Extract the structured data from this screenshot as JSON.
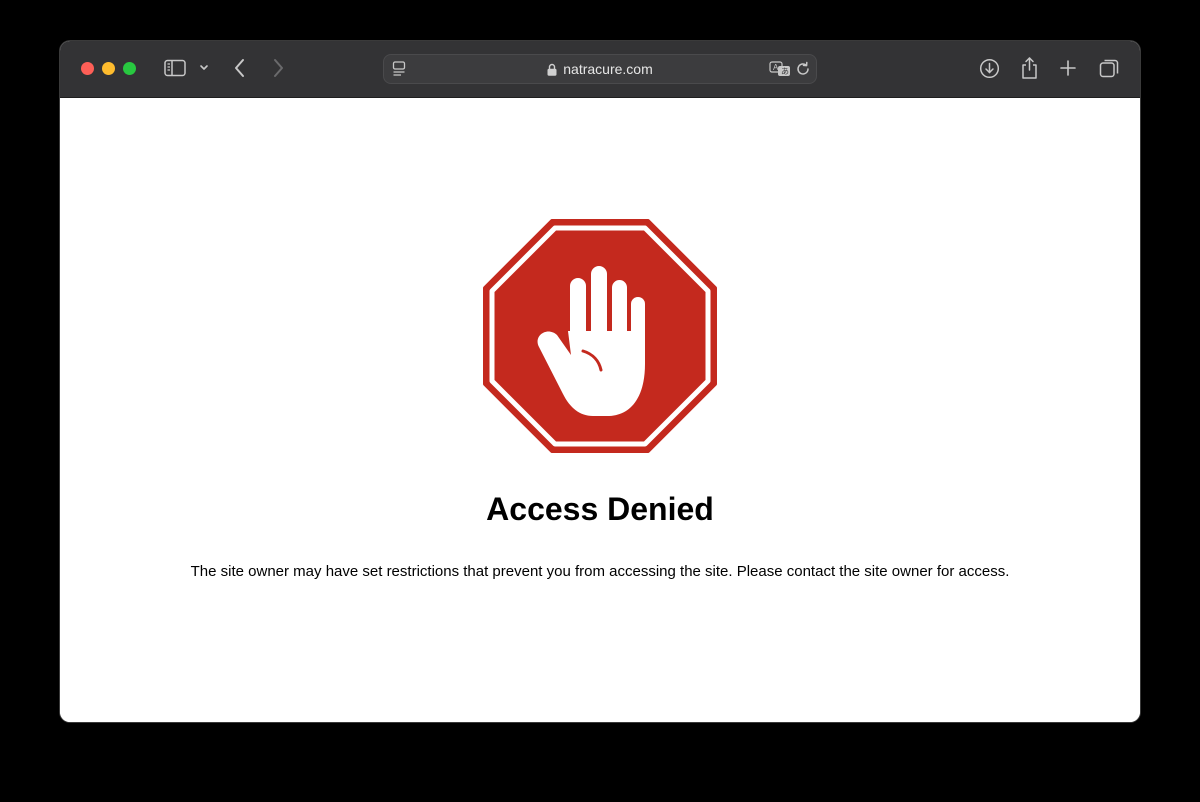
{
  "browser": {
    "url": "natracure.com",
    "icons": {
      "sidebar": "sidebar-icon",
      "sidebar_menu": "chevron-down-icon",
      "back": "back-arrow-icon",
      "forward": "forward-arrow-icon",
      "page_menu": "page-menu-icon",
      "lock": "lock-icon",
      "translate": "translate-icon",
      "reload": "reload-icon",
      "downloads": "download-icon",
      "share": "share-icon",
      "new_tab": "plus-icon",
      "tab_overview": "tabs-icon"
    }
  },
  "page": {
    "title": "Access Denied",
    "message": "The site owner may have set restrictions that prevent you from accessing the site. Please contact the site owner for access.",
    "icon": "stop-hand-icon"
  },
  "colors": {
    "stop_sign": "#c4291e",
    "toolbar": "#333335",
    "traffic_red": "#fe5f57",
    "traffic_yellow": "#febc2e",
    "traffic_green": "#28c840"
  }
}
